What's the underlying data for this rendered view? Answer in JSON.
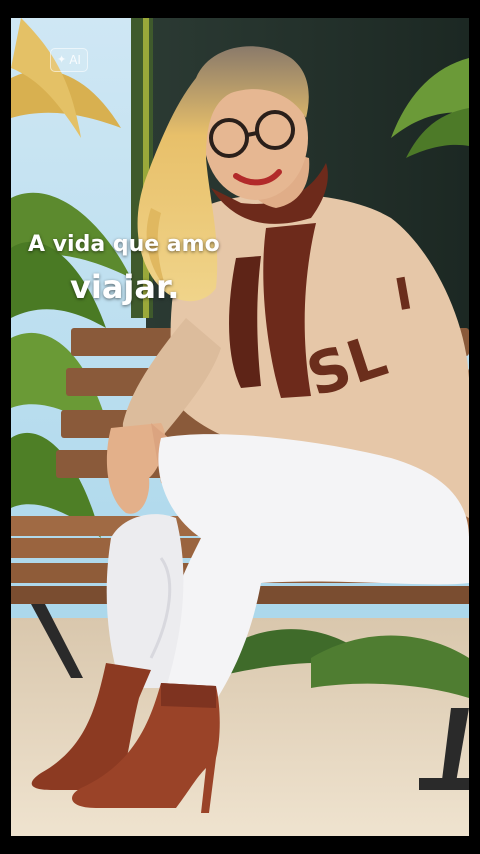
{
  "badge": {
    "label": "AI"
  },
  "caption": {
    "line1": "A vida que amo",
    "line2": "viajar."
  },
  "colors": {
    "background": "#000000",
    "sweater": "#e6c7a8",
    "sweater_letters": "#6b2e1c",
    "scarf": "#6d2a1b",
    "leggings": "#f4f4f6",
    "boots": "#8c3a22",
    "bench": "#8a5a3a",
    "wall": "#22312c"
  }
}
